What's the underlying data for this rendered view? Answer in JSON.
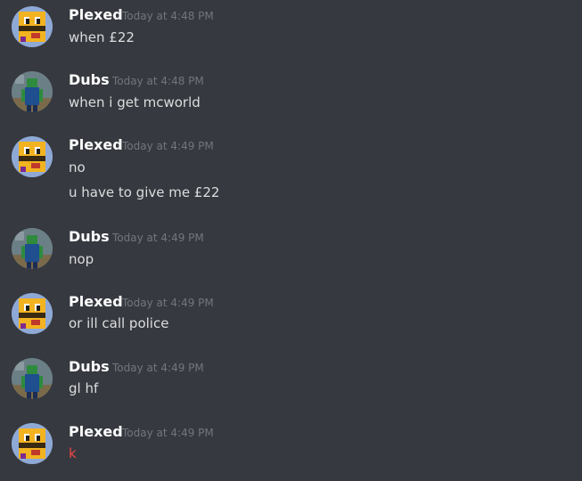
{
  "messages": [
    {
      "author": "Plexed",
      "timestamp": "Today at 4:48 PM",
      "avatar_icon": "bee-avatar-icon",
      "lines": [
        {
          "text": "when £22",
          "color": "#dcddde"
        }
      ]
    },
    {
      "author": "Dubs",
      "timestamp": "Today at 4:48 PM",
      "avatar_icon": "blocky-character-avatar-icon",
      "lines": [
        {
          "text": "when i get mcworld",
          "color": "#dcddde"
        }
      ]
    },
    {
      "author": "Plexed",
      "timestamp": "Today at 4:49 PM",
      "avatar_icon": "bee-avatar-icon",
      "lines": [
        {
          "text": "no",
          "color": "#dcddde"
        },
        {
          "text": "u have to give me £22",
          "color": "#dcddde"
        }
      ]
    },
    {
      "author": "Dubs",
      "timestamp": "Today at 4:49 PM",
      "avatar_icon": "blocky-character-avatar-icon",
      "lines": [
        {
          "text": "nop",
          "color": "#dcddde"
        }
      ]
    },
    {
      "author": "Plexed",
      "timestamp": "Today at 4:49 PM",
      "avatar_icon": "bee-avatar-icon",
      "lines": [
        {
          "text": "or ill call police",
          "color": "#dcddde"
        }
      ]
    },
    {
      "author": "Dubs",
      "timestamp": "Today at 4:49 PM",
      "avatar_icon": "blocky-character-avatar-icon",
      "lines": [
        {
          "text": "gl hf",
          "color": "#dcddde"
        }
      ]
    },
    {
      "author": "Plexed",
      "timestamp": "Today at 4:49 PM",
      "avatar_icon": "bee-avatar-icon",
      "lines": [
        {
          "text": "k",
          "color": "#f04747"
        }
      ]
    }
  ]
}
